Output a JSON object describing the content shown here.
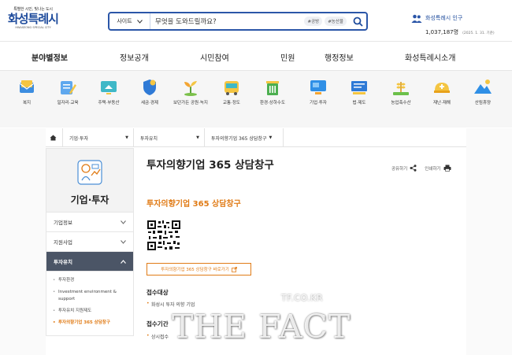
{
  "logo": {
    "tagline": "특별한 시민, 빛나는 도시",
    "name": "화성특례시",
    "subname": "HWASEONG SPECIAL CITY"
  },
  "search": {
    "scope": "사이트",
    "placeholder": "무엇을 도와드릴까요?",
    "chips": [
      "#공방",
      "#농산물"
    ]
  },
  "population": {
    "label": "화성특례시 인구",
    "value": "1,037,187명",
    "date": "(2025. 1. 31. 기준)"
  },
  "gnb": [
    "분야별정보",
    "정보공개",
    "시민참여",
    "민원",
    "행정정보",
    "화성특례시소개"
  ],
  "categories": [
    {
      "label": "복지",
      "icon": "mail-icon"
    },
    {
      "label": "일자리·교육",
      "icon": "pencil-icon"
    },
    {
      "label": "주택·부동산",
      "icon": "monitor-icon"
    },
    {
      "label": "세금·경제",
      "icon": "shield-icon"
    },
    {
      "label": "보던가든 공원·녹지",
      "icon": "sprout-icon"
    },
    {
      "label": "교통·정도",
      "icon": "bus-icon"
    },
    {
      "label": "환경·상하수도",
      "icon": "trash-icon"
    },
    {
      "label": "기업·투자",
      "icon": "display-icon"
    },
    {
      "label": "법·제도",
      "icon": "board-icon"
    },
    {
      "label": "농업축수산",
      "icon": "wheat-icon"
    },
    {
      "label": "재난·재해",
      "icon": "helmet-icon"
    },
    {
      "label": "산림휴양",
      "icon": "mountain-icon"
    }
  ],
  "breadcrumb": [
    "기업·투자",
    "투자유치",
    "투자의향기업 365 상담창구"
  ],
  "sidebar": {
    "title": "기업·투자",
    "menu": [
      "기업정보",
      "지원사업",
      "투자유치"
    ],
    "active_menu": "투자유치",
    "submenu": [
      "투자환경",
      "Investment environment & support",
      "투자유치 지원제도",
      "투자의향기업 365 상담창구"
    ]
  },
  "content": {
    "title": "투자의향기업 365 상담창구",
    "tools": [
      "공유하기",
      "인쇄하기"
    ],
    "subtitle": "투자의향기업 365 상담창구",
    "link_button": "투자의향기업 365 상담창구 바로가기",
    "sections": [
      {
        "title": "접수대상",
        "item": "화성시 투자 의향 기업"
      },
      {
        "title": "접수기간",
        "item": "상시접수"
      }
    ]
  },
  "watermark": {
    "small": "TF.CO.KR",
    "big": "THE FACT"
  }
}
